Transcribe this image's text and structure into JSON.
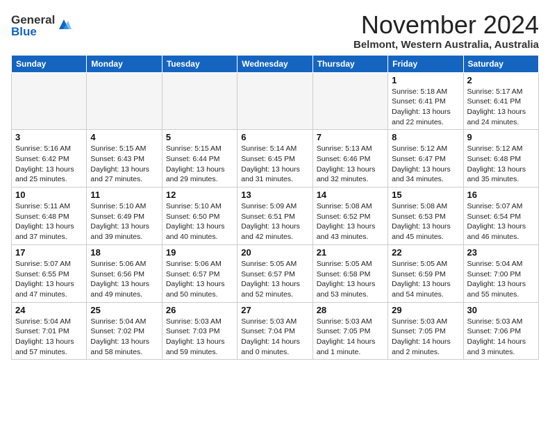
{
  "header": {
    "logo_general": "General",
    "logo_blue": "Blue",
    "month": "November 2024",
    "location": "Belmont, Western Australia, Australia"
  },
  "weekdays": [
    "Sunday",
    "Monday",
    "Tuesday",
    "Wednesday",
    "Thursday",
    "Friday",
    "Saturday"
  ],
  "weeks": [
    [
      {
        "day": "",
        "info": ""
      },
      {
        "day": "",
        "info": ""
      },
      {
        "day": "",
        "info": ""
      },
      {
        "day": "",
        "info": ""
      },
      {
        "day": "",
        "info": ""
      },
      {
        "day": "1",
        "info": "Sunrise: 5:18 AM\nSunset: 6:41 PM\nDaylight: 13 hours\nand 22 minutes."
      },
      {
        "day": "2",
        "info": "Sunrise: 5:17 AM\nSunset: 6:41 PM\nDaylight: 13 hours\nand 24 minutes."
      }
    ],
    [
      {
        "day": "3",
        "info": "Sunrise: 5:16 AM\nSunset: 6:42 PM\nDaylight: 13 hours\nand 25 minutes."
      },
      {
        "day": "4",
        "info": "Sunrise: 5:15 AM\nSunset: 6:43 PM\nDaylight: 13 hours\nand 27 minutes."
      },
      {
        "day": "5",
        "info": "Sunrise: 5:15 AM\nSunset: 6:44 PM\nDaylight: 13 hours\nand 29 minutes."
      },
      {
        "day": "6",
        "info": "Sunrise: 5:14 AM\nSunset: 6:45 PM\nDaylight: 13 hours\nand 31 minutes."
      },
      {
        "day": "7",
        "info": "Sunrise: 5:13 AM\nSunset: 6:46 PM\nDaylight: 13 hours\nand 32 minutes."
      },
      {
        "day": "8",
        "info": "Sunrise: 5:12 AM\nSunset: 6:47 PM\nDaylight: 13 hours\nand 34 minutes."
      },
      {
        "day": "9",
        "info": "Sunrise: 5:12 AM\nSunset: 6:48 PM\nDaylight: 13 hours\nand 35 minutes."
      }
    ],
    [
      {
        "day": "10",
        "info": "Sunrise: 5:11 AM\nSunset: 6:48 PM\nDaylight: 13 hours\nand 37 minutes."
      },
      {
        "day": "11",
        "info": "Sunrise: 5:10 AM\nSunset: 6:49 PM\nDaylight: 13 hours\nand 39 minutes."
      },
      {
        "day": "12",
        "info": "Sunrise: 5:10 AM\nSunset: 6:50 PM\nDaylight: 13 hours\nand 40 minutes."
      },
      {
        "day": "13",
        "info": "Sunrise: 5:09 AM\nSunset: 6:51 PM\nDaylight: 13 hours\nand 42 minutes."
      },
      {
        "day": "14",
        "info": "Sunrise: 5:08 AM\nSunset: 6:52 PM\nDaylight: 13 hours\nand 43 minutes."
      },
      {
        "day": "15",
        "info": "Sunrise: 5:08 AM\nSunset: 6:53 PM\nDaylight: 13 hours\nand 45 minutes."
      },
      {
        "day": "16",
        "info": "Sunrise: 5:07 AM\nSunset: 6:54 PM\nDaylight: 13 hours\nand 46 minutes."
      }
    ],
    [
      {
        "day": "17",
        "info": "Sunrise: 5:07 AM\nSunset: 6:55 PM\nDaylight: 13 hours\nand 47 minutes."
      },
      {
        "day": "18",
        "info": "Sunrise: 5:06 AM\nSunset: 6:56 PM\nDaylight: 13 hours\nand 49 minutes."
      },
      {
        "day": "19",
        "info": "Sunrise: 5:06 AM\nSunset: 6:57 PM\nDaylight: 13 hours\nand 50 minutes."
      },
      {
        "day": "20",
        "info": "Sunrise: 5:05 AM\nSunset: 6:57 PM\nDaylight: 13 hours\nand 52 minutes."
      },
      {
        "day": "21",
        "info": "Sunrise: 5:05 AM\nSunset: 6:58 PM\nDaylight: 13 hours\nand 53 minutes."
      },
      {
        "day": "22",
        "info": "Sunrise: 5:05 AM\nSunset: 6:59 PM\nDaylight: 13 hours\nand 54 minutes."
      },
      {
        "day": "23",
        "info": "Sunrise: 5:04 AM\nSunset: 7:00 PM\nDaylight: 13 hours\nand 55 minutes."
      }
    ],
    [
      {
        "day": "24",
        "info": "Sunrise: 5:04 AM\nSunset: 7:01 PM\nDaylight: 13 hours\nand 57 minutes."
      },
      {
        "day": "25",
        "info": "Sunrise: 5:04 AM\nSunset: 7:02 PM\nDaylight: 13 hours\nand 58 minutes."
      },
      {
        "day": "26",
        "info": "Sunrise: 5:03 AM\nSunset: 7:03 PM\nDaylight: 13 hours\nand 59 minutes."
      },
      {
        "day": "27",
        "info": "Sunrise: 5:03 AM\nSunset: 7:04 PM\nDaylight: 14 hours\nand 0 minutes."
      },
      {
        "day": "28",
        "info": "Sunrise: 5:03 AM\nSunset: 7:05 PM\nDaylight: 14 hours\nand 1 minute."
      },
      {
        "day": "29",
        "info": "Sunrise: 5:03 AM\nSunset: 7:05 PM\nDaylight: 14 hours\nand 2 minutes."
      },
      {
        "day": "30",
        "info": "Sunrise: 5:03 AM\nSunset: 7:06 PM\nDaylight: 14 hours\nand 3 minutes."
      }
    ]
  ]
}
